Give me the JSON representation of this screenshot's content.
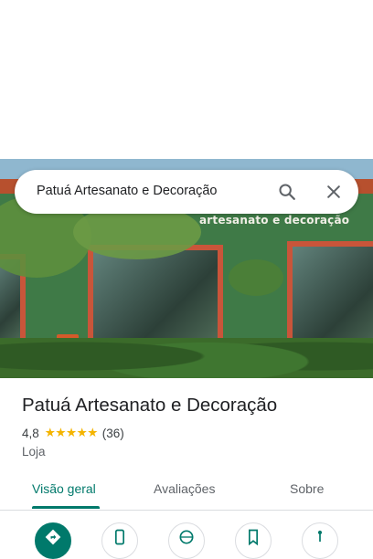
{
  "search": {
    "query": "Patuá Artesanato e Decoração",
    "search_icon": "search-icon",
    "close_icon": "close-icon"
  },
  "photo": {
    "sign_text": "artesanato e decoração"
  },
  "place": {
    "name": "Patuá Artesanato e Decoração",
    "rating": "4,8",
    "stars": "★★★★★",
    "reviews": "(36)",
    "category": "Loja"
  },
  "tabs": [
    {
      "label": "Visão geral",
      "active": true
    },
    {
      "label": "Avaliações",
      "active": false
    },
    {
      "label": "Sobre",
      "active": false
    }
  ],
  "actions": [
    {
      "icon": "directions-icon"
    },
    {
      "icon": "phone-icon"
    },
    {
      "icon": "website-icon"
    },
    {
      "icon": "save-icon"
    },
    {
      "icon": "share-icon"
    }
  ],
  "colors": {
    "accent": "#00796b",
    "star": "#f4b400",
    "text_primary": "#202124",
    "text_secondary": "#5f6368"
  }
}
